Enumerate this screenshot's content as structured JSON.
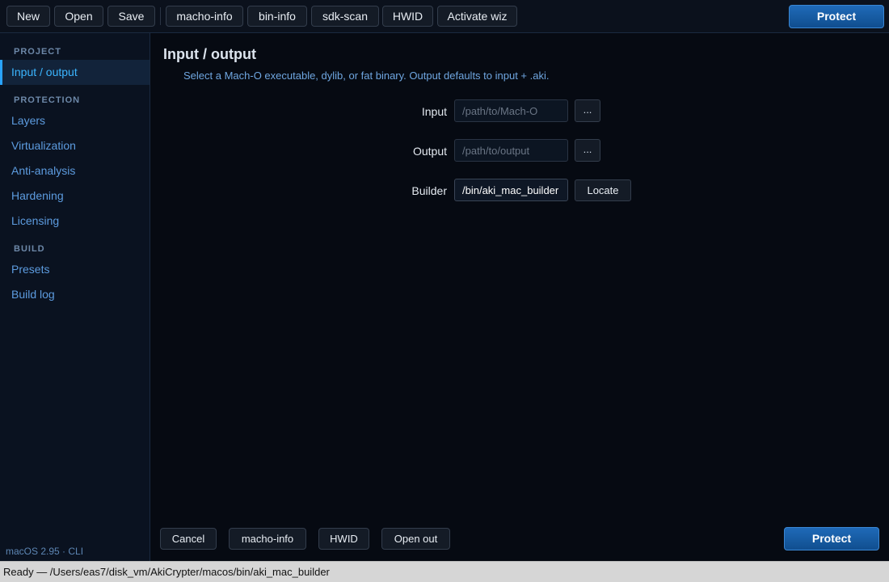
{
  "toolbar": {
    "buttons": [
      "New",
      "Open",
      "Save",
      "macho-info",
      "bin-info",
      "sdk-scan",
      "HWID",
      "Activate wiz"
    ],
    "protect_label": "Protect"
  },
  "sidebar": {
    "sections": [
      {
        "label": "PROJECT",
        "items": [
          "Input / output"
        ]
      },
      {
        "label": "PROTECTION",
        "items": [
          "Layers",
          "Virtualization",
          "Anti-analysis",
          "Hardening",
          "Licensing"
        ]
      },
      {
        "label": "BUILD",
        "items": [
          "Presets",
          "Build log"
        ]
      }
    ],
    "active_item": "Input / output",
    "version": "macOS 2.95 · CLI"
  },
  "main": {
    "title": "Input / output",
    "description": "Select a Mach-O executable, dylib, or fat binary. Output defaults to input + .aki.",
    "fields": {
      "input": {
        "label": "Input",
        "placeholder": "/path/to/Mach-O",
        "value": "",
        "button": "..."
      },
      "output": {
        "label": "Output",
        "placeholder": "/path/to/output",
        "value": "",
        "button": "..."
      },
      "builder": {
        "label": "Builder",
        "placeholder": "",
        "value": "/bin/aki_mac_builder",
        "button": "Locate"
      }
    }
  },
  "footer": {
    "buttons": [
      "Cancel",
      "macho-info",
      "HWID",
      "Open out"
    ],
    "protect_label": "Protect"
  },
  "status": {
    "text": "Ready — /Users/eas7/disk_vm/AkiCrypter/macos/bin/aki_mac_builder"
  },
  "colors": {
    "accent": "#29a3ff",
    "primary_button": "#1a5ea6",
    "background": "#070b14"
  }
}
